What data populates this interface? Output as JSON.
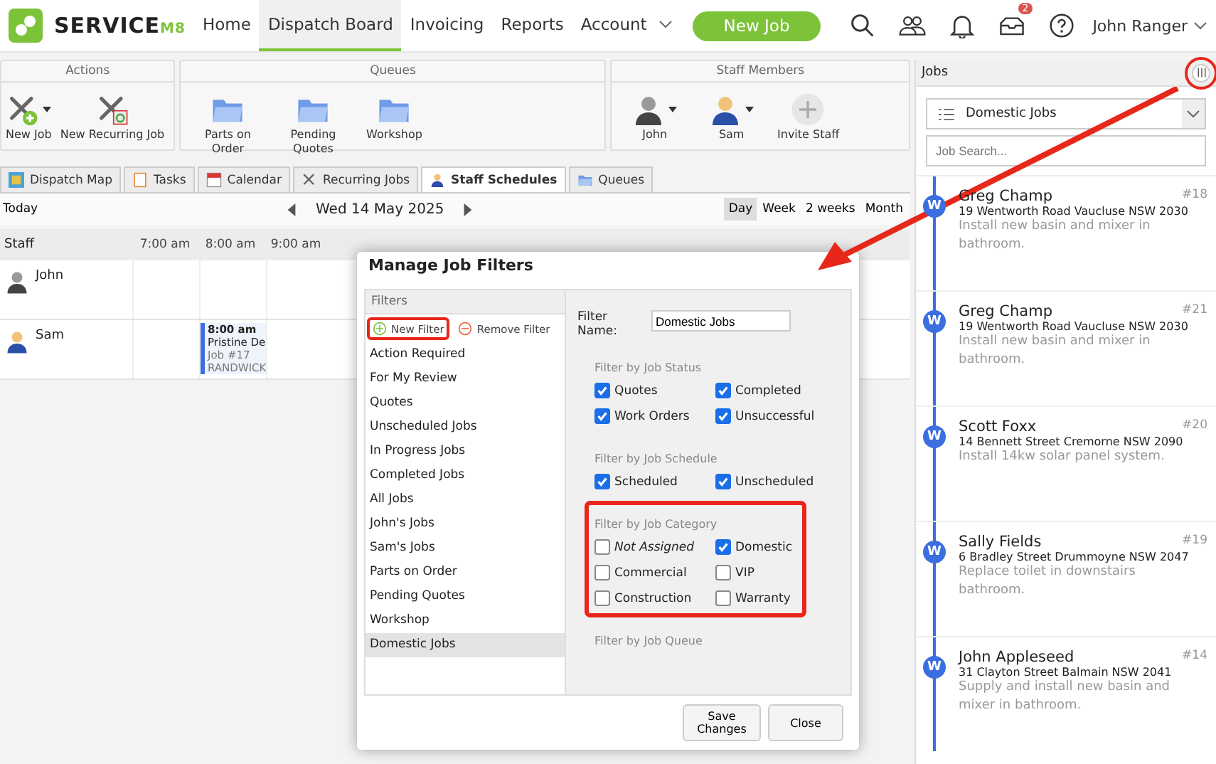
{
  "nav": {
    "logo": "SERVICE",
    "logo_suffix": "M8",
    "items": [
      {
        "label": "Home",
        "selected": false,
        "caret": false
      },
      {
        "label": "Dispatch Board",
        "selected": true,
        "caret": false
      },
      {
        "label": "Invoicing",
        "selected": false,
        "caret": false
      },
      {
        "label": "Reports",
        "selected": false,
        "caret": false
      },
      {
        "label": "Account",
        "selected": false,
        "caret": true
      }
    ],
    "new_job": "New Job",
    "inbox_badge": "2",
    "user": "John Ranger"
  },
  "ribbon": [
    {
      "title": "Actions",
      "items": [
        {
          "label": "New Job",
          "kind": "tool-add",
          "dropdown": true
        },
        {
          "label": "New Recurring Job",
          "kind": "tool-recurring",
          "dropdown": false
        }
      ]
    },
    {
      "title": "Queues",
      "items": [
        {
          "label": "Parts on Order",
          "kind": "folder",
          "dropdown": false
        },
        {
          "label": "Pending Quotes",
          "kind": "folder",
          "dropdown": false
        },
        {
          "label": "Workshop",
          "kind": "folder",
          "dropdown": false
        }
      ]
    },
    {
      "title": "Staff Members",
      "items": [
        {
          "label": "John",
          "kind": "staff-grey",
          "dropdown": true
        },
        {
          "label": "Sam",
          "kind": "staff-blue",
          "dropdown": true
        },
        {
          "label": "Invite Staff",
          "kind": "add",
          "dropdown": false
        }
      ]
    }
  ],
  "tabs": [
    {
      "label": "Dispatch Map",
      "kind": "map",
      "selected": false
    },
    {
      "label": "Tasks",
      "kind": "tasks",
      "selected": false
    },
    {
      "label": "Calendar",
      "kind": "calendar",
      "selected": false
    },
    {
      "label": "Recurring Jobs",
      "kind": "tool",
      "selected": false
    },
    {
      "label": "Staff Schedules",
      "kind": "staff",
      "selected": true
    },
    {
      "label": "Queues",
      "kind": "folder",
      "selected": false
    }
  ],
  "date_bar": {
    "today": "Today",
    "date": "Wed 14 May 2025",
    "views": [
      {
        "label": "Day",
        "selected": true
      },
      {
        "label": "Week",
        "selected": false
      },
      {
        "label": "2 weeks",
        "selected": false
      },
      {
        "label": "Month",
        "selected": false
      }
    ]
  },
  "schedule": {
    "staff_header": "Staff",
    "times": [
      "7:00 am",
      "8:00 am",
      "9:00 am"
    ],
    "rows": [
      {
        "name": "John",
        "kind": "staff-grey"
      },
      {
        "name": "Sam",
        "kind": "staff-blue",
        "job": {
          "time": "8:00 am",
          "title": "Pristine De",
          "number": "Job #17",
          "suburb": "RANDWICK"
        }
      }
    ]
  },
  "modal": {
    "title": "Manage Job Filters",
    "filters_heading": "Filters",
    "new_filter": {
      "label": "New Filter",
      "highlighted": true
    },
    "remove_filter": {
      "label": "Remove Filter",
      "highlighted": false
    },
    "filters": [
      {
        "label": "Action Required",
        "selected": false
      },
      {
        "label": "For My Review",
        "selected": false
      },
      {
        "label": "Quotes",
        "selected": false
      },
      {
        "label": "Unscheduled Jobs",
        "selected": false
      },
      {
        "label": "In Progress Jobs",
        "selected": false
      },
      {
        "label": "Completed Jobs",
        "selected": false
      },
      {
        "label": "All Jobs",
        "selected": false
      },
      {
        "label": "John's Jobs",
        "selected": false
      },
      {
        "label": "Sam's Jobs",
        "selected": false
      },
      {
        "label": "Parts on Order",
        "selected": false
      },
      {
        "label": "Pending Quotes",
        "selected": false
      },
      {
        "label": "Workshop",
        "selected": false
      },
      {
        "label": "Domestic Jobs",
        "selected": true
      }
    ],
    "name_label": "Filter Name:",
    "name_value": "Domestic Jobs",
    "sections": [
      {
        "title": "Filter by Job Status",
        "highlighted": false,
        "options": [
          {
            "label": "Quotes",
            "checked": true,
            "italic": false
          },
          {
            "label": "Completed",
            "checked": true,
            "italic": false
          },
          {
            "label": "Work Orders",
            "checked": true,
            "italic": false
          },
          {
            "label": "Unsuccessful",
            "checked": true,
            "italic": false
          }
        ]
      },
      {
        "title": "Filter by Job Schedule",
        "highlighted": false,
        "options": [
          {
            "label": "Scheduled",
            "checked": true,
            "italic": false
          },
          {
            "label": "Unscheduled",
            "checked": true,
            "italic": false
          }
        ]
      },
      {
        "title": "Filter by Job Category",
        "highlighted": true,
        "options": [
          {
            "label": "Not Assigned",
            "checked": false,
            "italic": true
          },
          {
            "label": "Domestic",
            "checked": true,
            "italic": false
          },
          {
            "label": "Commercial",
            "checked": false,
            "italic": false
          },
          {
            "label": "VIP",
            "checked": false,
            "italic": false
          },
          {
            "label": "Construction",
            "checked": false,
            "italic": false
          },
          {
            "label": "Warranty",
            "checked": false,
            "italic": false
          }
        ]
      },
      {
        "title": "Filter by Job Queue",
        "highlighted": false
      }
    ],
    "buttons": [
      "Save Changes",
      "Close"
    ]
  },
  "jobs_panel": {
    "title": "Jobs",
    "options_highlighted": true,
    "filter": "Domestic Jobs",
    "search_placeholder": "Job Search...",
    "jobs": [
      {
        "badge": "W",
        "name": "Greg Champ",
        "number": "#18",
        "address": "19 Wentworth Road Vaucluse NSW 2030",
        "description": "Install new basin and mixer in bathroom."
      },
      {
        "badge": "W",
        "name": "Greg Champ",
        "number": "#21",
        "address": "19 Wentworth Road Vaucluse NSW 2030",
        "description": "Install new basin and mixer in bathroom."
      },
      {
        "badge": "W",
        "name": "Scott Foxx",
        "number": "#20",
        "address": "14 Bennett Street Cremorne NSW 2090",
        "description": "Install 14kw solar panel system."
      },
      {
        "badge": "W",
        "name": "Sally Fields",
        "number": "#19",
        "address": "6 Bradley Street Drummoyne NSW 2047",
        "description": "Replace toilet in downstairs bathroom."
      },
      {
        "badge": "W",
        "name": "John Appleseed",
        "number": "#14",
        "address": "31 Clayton Street Balmain NSW 2041",
        "description": "Supply and install new basin and mixer in bathroom."
      }
    ]
  },
  "annotation_arrow": true
}
